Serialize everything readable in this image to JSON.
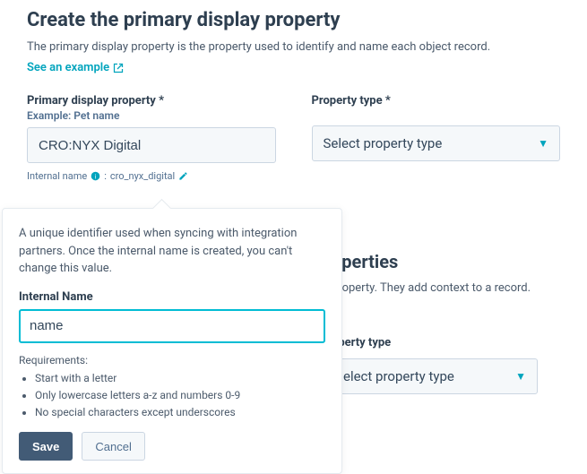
{
  "header": {
    "title": "Create the primary display property",
    "description": "The primary display property is the property used to identify and name each object record.",
    "example_link": "See an example"
  },
  "primary": {
    "label": "Primary display property *",
    "sublabel": "Example: Pet name",
    "value": "CRO:NYX Digital",
    "internal_prefix": "Internal name",
    "internal_value": "cro_nyx_digital"
  },
  "property_type": {
    "label": "Property type *",
    "placeholder": "Select property type"
  },
  "secondary_section": {
    "title_fragment": "operties",
    "desc_fragment": "property. They add context to a record.",
    "type_label_fragment": "operty type",
    "type_placeholder_fragment": "elect property type"
  },
  "popover": {
    "desc": "A unique identifier used when syncing with integration partners. Once the internal name is created, you can't change this value.",
    "label": "Internal Name",
    "value": "name",
    "req_label": "Requirements:",
    "reqs": [
      "Start with a letter",
      "Only lowercase letters a-z and numbers 0-9",
      "No special characters except underscores"
    ],
    "save": "Save",
    "cancel": "Cancel"
  }
}
